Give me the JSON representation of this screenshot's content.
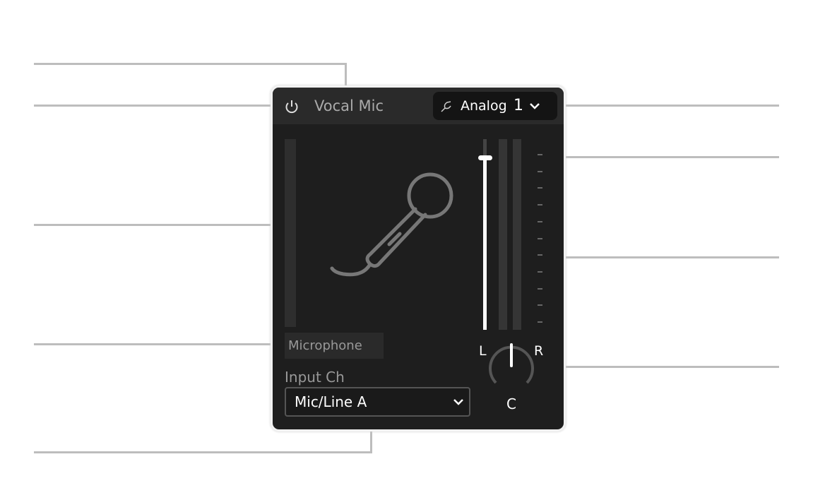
{
  "track": {
    "name": "Vocal Mic",
    "power": "power-icon"
  },
  "output": {
    "label": "Analog",
    "number": "1",
    "icon": "cable-icon"
  },
  "instrument": {
    "label": "Microphone",
    "icon": "microphone-icon"
  },
  "input": {
    "label": "Input Ch",
    "value": "Mic/Line A"
  },
  "pan": {
    "left": "L",
    "right": "R",
    "center": "C",
    "value": 0
  },
  "fader": {
    "level": 0.9
  },
  "colors": {
    "panel": "#1e1e1e",
    "header": "#2a2a2a",
    "callout": "#bdbdbd"
  }
}
